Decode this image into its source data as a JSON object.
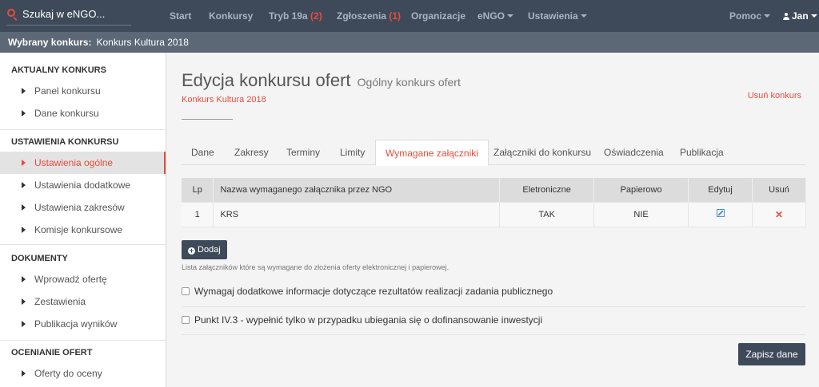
{
  "navbar": {
    "search_placeholder": "Szukaj w eNGO...",
    "items": [
      {
        "label": "Start"
      },
      {
        "label": "Konkursy"
      },
      {
        "label": "Tryb 19a",
        "count": "(2)"
      },
      {
        "label": "Zgłoszenia",
        "count": "(1)"
      },
      {
        "label": "Organizacje"
      },
      {
        "label": "eNGO"
      },
      {
        "label": "Ustawienia"
      }
    ],
    "help": "Pomoc",
    "user": "Jan"
  },
  "contest_bar": {
    "label": "Wybrany konkurs:",
    "value": "Konkurs Kultura 2018"
  },
  "sidebar": {
    "sections": [
      {
        "title": "AKTUALNY KONKURS",
        "items": [
          "Panel konkursu",
          "Dane konkursu"
        ]
      },
      {
        "title": "USTAWIENIA KONKURSU",
        "items": [
          "Ustawienia ogólne",
          "Ustawienia dodatkowe",
          "Ustawienia zakresów",
          "Komisje konkursowe"
        ]
      },
      {
        "title": "DOKUMENTY",
        "items": [
          "Wprowadź ofertę",
          "Zestawienia",
          "Publikacja wyników"
        ]
      },
      {
        "title": "OCENIANIE OFERT",
        "items": [
          "Oferty do oceny"
        ]
      }
    ],
    "active_item": "Ustawienia ogólne"
  },
  "main": {
    "title": "Edycja konkursu ofert",
    "subtitle": "Ogólny konkurs ofert",
    "contest_name": "Konkurs Kultura 2018",
    "delete_link": "Usuń konkurs",
    "tabs": [
      "Dane",
      "Zakresy",
      "Terminy",
      "Limity",
      "Wymagane załączniki",
      "Załączniki do konkursu",
      "Oświadczenia",
      "Publikacja"
    ],
    "active_tab": "Wymagane załączniki",
    "table": {
      "headers": [
        "Lp",
        "Nazwa wymaganego załącznika przez NGO",
        "Eletroniczne",
        "Papierowo",
        "Edytuj",
        "Usuń"
      ],
      "rows": [
        {
          "lp": "1",
          "name": "KRS",
          "electronic": "TAK",
          "paper": "NIE"
        }
      ]
    },
    "add_button": "Dodaj",
    "hint": "Lista załączników które są wymagane do złożenia oferty elektronicznej i papierowej.",
    "checkboxes": [
      {
        "label": "Wymagaj dodatkowe informacje dotyczące rezultatów realizacji zadania publicznego",
        "checked": false
      },
      {
        "label": "Punkt IV.3 - wypełnić tylko w przypadku ubiegania się o dofinansowanie inwestycji",
        "checked": false
      }
    ],
    "save_button": "Zapisz dane"
  },
  "colors": {
    "navbar_bg": "#3e4a5a",
    "accent_red": "#e74c3c",
    "contest_bar_bg": "#5c6876"
  }
}
